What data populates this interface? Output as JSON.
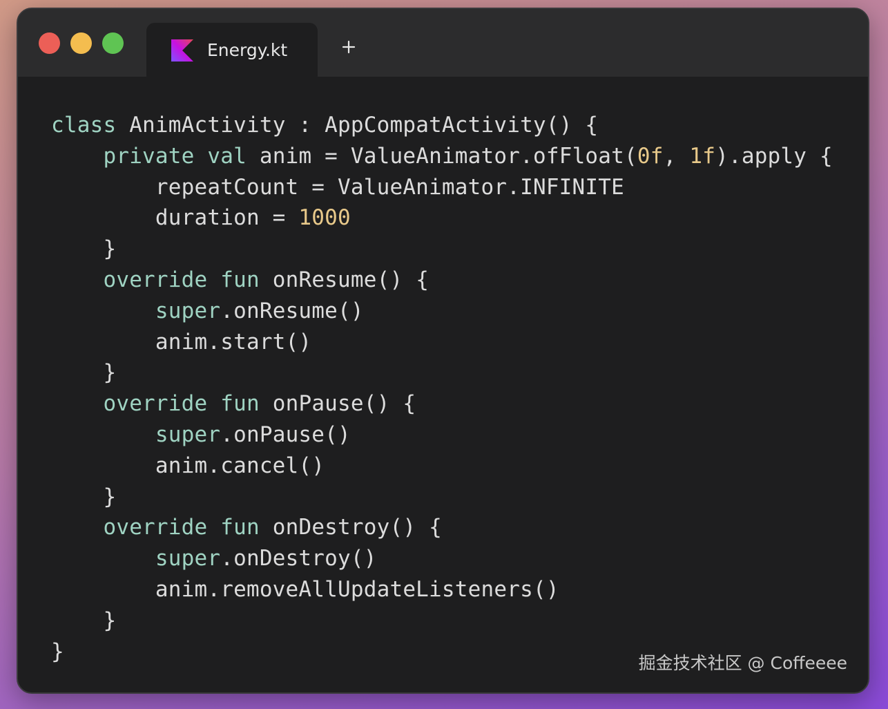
{
  "window": {
    "traffic_lights": [
      {
        "name": "close",
        "color": "#ec5f57"
      },
      {
        "name": "minimize",
        "color": "#f4bd4f"
      },
      {
        "name": "maximize",
        "color": "#5fc453"
      }
    ],
    "tab": {
      "icon": "kotlin-logo-icon",
      "label": "Energy.kt"
    },
    "new_tab_icon": "plus-icon"
  },
  "colors": {
    "background": "#1e1e1f",
    "titlebar": "#2c2c2d",
    "keyword": "#9fd3c2",
    "number": "#e8c98a",
    "text": "#dcdcdc"
  },
  "code": {
    "lines": [
      [
        {
          "t": "kw",
          "v": "class"
        },
        {
          "t": "plain",
          "v": " AnimActivity : AppCompatActivity() {"
        }
      ],
      [
        {
          "t": "plain",
          "v": "    "
        },
        {
          "t": "kw",
          "v": "private"
        },
        {
          "t": "plain",
          "v": " "
        },
        {
          "t": "kw",
          "v": "val"
        },
        {
          "t": "plain",
          "v": " anim = ValueAnimator.ofFloat("
        },
        {
          "t": "num",
          "v": "0f"
        },
        {
          "t": "plain",
          "v": ", "
        },
        {
          "t": "num",
          "v": "1f"
        },
        {
          "t": "plain",
          "v": ").apply {"
        }
      ],
      [
        {
          "t": "plain",
          "v": "        repeatCount = ValueAnimator.INFINITE"
        }
      ],
      [
        {
          "t": "plain",
          "v": "        duration = "
        },
        {
          "t": "num",
          "v": "1000"
        }
      ],
      [
        {
          "t": "plain",
          "v": "    }"
        }
      ],
      [
        {
          "t": "plain",
          "v": "    "
        },
        {
          "t": "kw",
          "v": "override"
        },
        {
          "t": "plain",
          "v": " "
        },
        {
          "t": "kw",
          "v": "fun"
        },
        {
          "t": "plain",
          "v": " onResume() {"
        }
      ],
      [
        {
          "t": "plain",
          "v": "        "
        },
        {
          "t": "kw",
          "v": "super"
        },
        {
          "t": "plain",
          "v": ".onResume()"
        }
      ],
      [
        {
          "t": "plain",
          "v": "        anim.start()"
        }
      ],
      [
        {
          "t": "plain",
          "v": "    }"
        }
      ],
      [
        {
          "t": "plain",
          "v": "    "
        },
        {
          "t": "kw",
          "v": "override"
        },
        {
          "t": "plain",
          "v": " "
        },
        {
          "t": "kw",
          "v": "fun"
        },
        {
          "t": "plain",
          "v": " onPause() {"
        }
      ],
      [
        {
          "t": "plain",
          "v": "        "
        },
        {
          "t": "kw",
          "v": "super"
        },
        {
          "t": "plain",
          "v": ".onPause()"
        }
      ],
      [
        {
          "t": "plain",
          "v": "        anim.cancel()"
        }
      ],
      [
        {
          "t": "plain",
          "v": "    }"
        }
      ],
      [
        {
          "t": "plain",
          "v": "    "
        },
        {
          "t": "kw",
          "v": "override"
        },
        {
          "t": "plain",
          "v": " "
        },
        {
          "t": "kw",
          "v": "fun"
        },
        {
          "t": "plain",
          "v": " onDestroy() {"
        }
      ],
      [
        {
          "t": "plain",
          "v": "        "
        },
        {
          "t": "kw",
          "v": "super"
        },
        {
          "t": "plain",
          "v": ".onDestroy()"
        }
      ],
      [
        {
          "t": "plain",
          "v": "        anim.removeAllUpdateListeners()"
        }
      ],
      [
        {
          "t": "plain",
          "v": "    }"
        }
      ],
      [
        {
          "t": "plain",
          "v": "}"
        }
      ]
    ]
  },
  "watermark": "掘金技术社区 @ Coffeeee"
}
